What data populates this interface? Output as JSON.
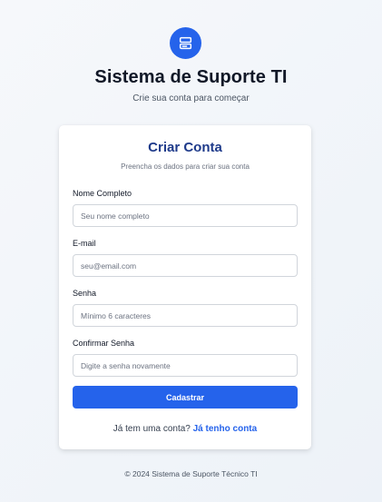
{
  "header": {
    "logo_icon": "server-icon",
    "title": "Sistema de Suporte TI",
    "subtitle": "Crie sua conta para começar"
  },
  "card": {
    "title": "Criar Conta",
    "subtitle": "Preencha os dados para criar sua conta",
    "fields": [
      {
        "label": "Nome Completo",
        "placeholder": "Seu nome completo",
        "value": ""
      },
      {
        "label": "E-mail",
        "placeholder": "seu@email.com",
        "value": ""
      },
      {
        "label": "Senha",
        "placeholder": "Mínimo 6 caracteres",
        "value": ""
      },
      {
        "label": "Confirmar Senha",
        "placeholder": "Digite a senha novamente",
        "value": ""
      }
    ],
    "submit_label": "Cadastrar",
    "login_prompt": "Já tem uma conta?",
    "login_link": "Já tenho conta"
  },
  "footer": {
    "text": "© 2024 Sistema de Suporte Técnico TI"
  },
  "colors": {
    "accent": "#2563eb",
    "card_title": "#1e3a8a"
  }
}
